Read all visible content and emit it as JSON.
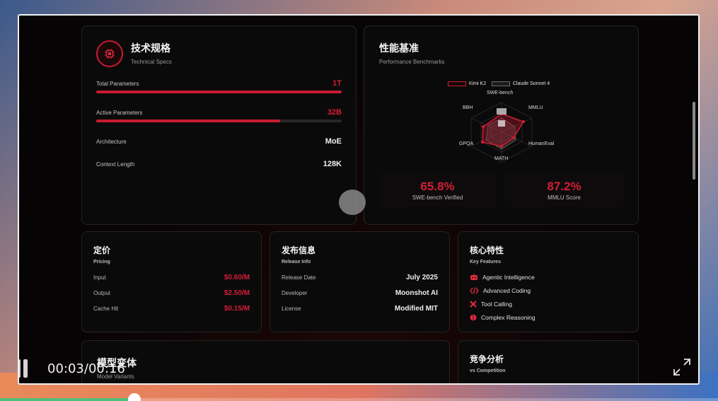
{
  "player": {
    "time_display": "00:03/00:16",
    "progress_fraction": 0.1875
  },
  "specs": {
    "title": "技术规格",
    "subtitle": "Technical Specs",
    "rows": [
      {
        "label": "Total Parameters",
        "value": "1T",
        "fill": 1.0
      },
      {
        "label": "Active Parameters",
        "value": "32B",
        "fill": 0.75
      },
      {
        "label": "Architecture",
        "value": "MoE"
      },
      {
        "label": "Context Length",
        "value": "128K"
      }
    ]
  },
  "benchmarks": {
    "title": "性能基准",
    "subtitle": "Performance Benchmarks",
    "legend": [
      "Kimi K2",
      "Claude Sonnet 4"
    ],
    "axes": [
      "SWE-bench",
      "MMLU",
      "HumanEval",
      "MATH",
      "GPQA",
      "BBH"
    ],
    "scores": [
      {
        "value": "65.8%",
        "label": "SWE-bench Verified"
      },
      {
        "value": "87.2%",
        "label": "MMLU Score"
      }
    ]
  },
  "pricing": {
    "title": "定价",
    "subtitle": "Pricing",
    "rows": [
      {
        "label": "Input",
        "value": "$0.60/M"
      },
      {
        "label": "Output",
        "value": "$2.50/M"
      },
      {
        "label": "Cache Hit",
        "value": "$0.15/M"
      }
    ]
  },
  "release": {
    "title": "发布信息",
    "subtitle": "Release Info",
    "rows": [
      {
        "label": "Release Date",
        "value": "July 2025"
      },
      {
        "label": "Developer",
        "value": "Moonshot AI"
      },
      {
        "label": "License",
        "value": "Modified MIT"
      }
    ]
  },
  "features": {
    "title": "核心特性",
    "subtitle": "Key Features",
    "items": [
      {
        "icon": "robot-icon",
        "label": "Agentic Intelligence"
      },
      {
        "icon": "code-icon",
        "label": "Advanced Coding"
      },
      {
        "icon": "tools-icon",
        "label": "Tool Calling"
      },
      {
        "icon": "brain-icon",
        "label": "Complex Reasoning"
      }
    ]
  },
  "variants": {
    "title": "模型变体",
    "subtitle": "Model Variants"
  },
  "competition": {
    "title": "竞争分析",
    "subtitle": "vs Competition"
  },
  "colors": {
    "accent": "#c81b30",
    "progress_played": "#4fbf7a"
  }
}
